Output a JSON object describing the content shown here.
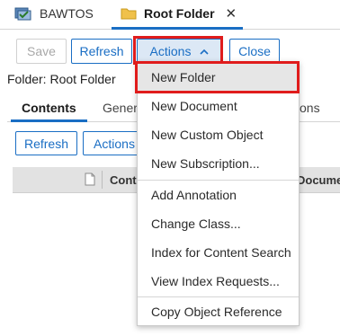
{
  "tabs": {
    "bawtos_label": "BAWTOS",
    "root_folder_label": "Root Folder",
    "close_glyph": "✕"
  },
  "toolbar": {
    "save_label": "Save",
    "refresh_label": "Refresh",
    "actions_label": "Actions",
    "close_label": "Close"
  },
  "folder": {
    "label": "Folder: Root Folder"
  },
  "subtabs": {
    "contents_label": "Contents",
    "general_label": "Genera",
    "permissions_partial": "ons"
  },
  "content_toolbar": {
    "refresh_label": "Refresh",
    "actions_label": "Actions"
  },
  "grid": {
    "columns": [
      "Conta",
      "Documen"
    ]
  },
  "menu": {
    "items": [
      "New Folder",
      "New Document",
      "New Custom Object",
      "New Subscription...",
      "Add Annotation",
      "Change Class...",
      "Index for Content Search",
      "View Index Requests...",
      "Copy Object Reference"
    ]
  },
  "colors": {
    "accent": "#1a6ec4",
    "highlight": "#e01c1c",
    "folder_icon": "#f0c14b"
  }
}
